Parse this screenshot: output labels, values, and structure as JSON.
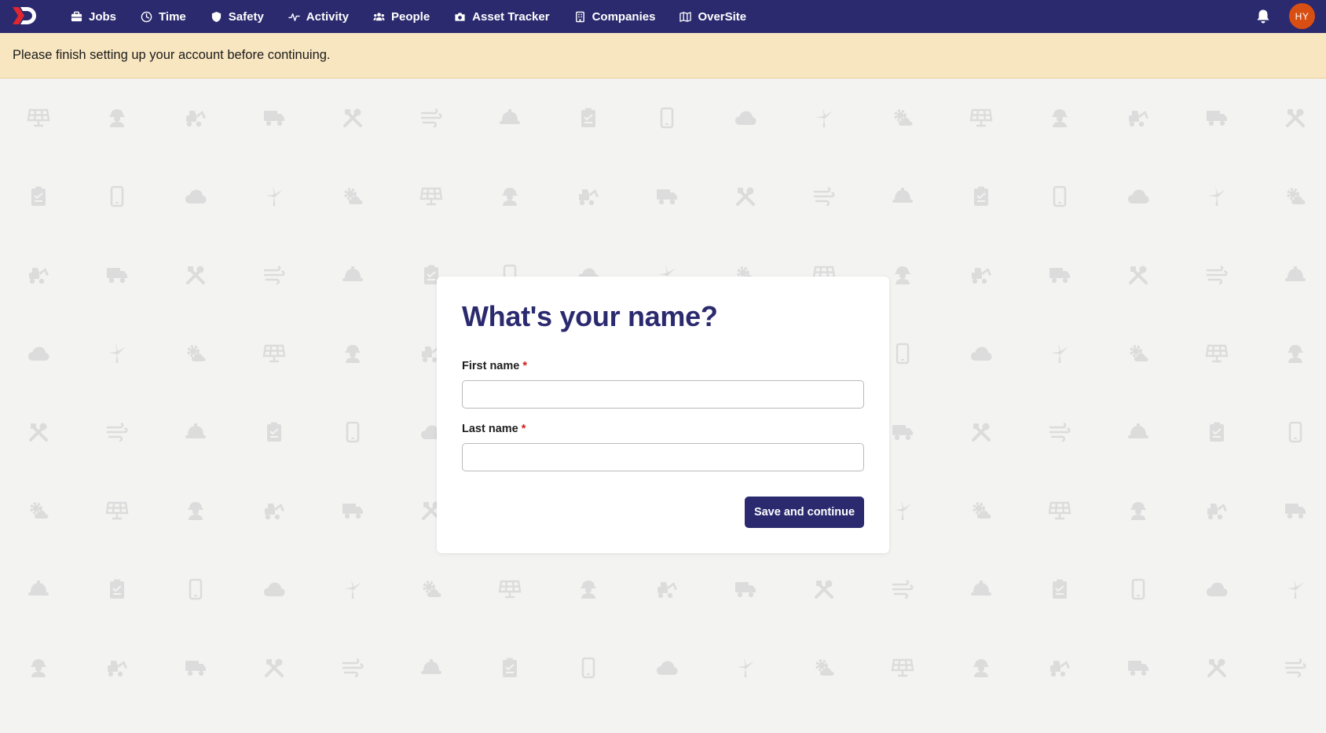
{
  "nav": {
    "items": [
      {
        "label": "Jobs",
        "icon": "briefcase-icon"
      },
      {
        "label": "Time",
        "icon": "clock-icon"
      },
      {
        "label": "Safety",
        "icon": "shield-icon"
      },
      {
        "label": "Activity",
        "icon": "activity-pulse-icon"
      },
      {
        "label": "People",
        "icon": "people-icon"
      },
      {
        "label": "Asset Tracker",
        "icon": "camera-icon"
      },
      {
        "label": "Companies",
        "icon": "building-icon"
      },
      {
        "label": "OverSite",
        "icon": "map-icon"
      }
    ],
    "avatar_initials": "HY",
    "colors": {
      "nav_bg": "#2b2a6f",
      "logo_accent": "#e0262f",
      "avatar_bg": "#d94f13"
    }
  },
  "banner": {
    "text": "Please finish setting up your account before continuing.",
    "bg": "#f8e6c0"
  },
  "form": {
    "title": "What's your name?",
    "first_name_label": "First name",
    "first_name_value": "",
    "last_name_label": "Last name",
    "last_name_value": "",
    "required_marker": "*",
    "save_label": "Save and continue"
  },
  "background_icons": [
    "solar-panel-icon",
    "worker-icon",
    "excavator-icon",
    "truck-icon",
    "tools-icon",
    "wind-icon",
    "hardhat-icon",
    "clipboard-icon",
    "phone-icon",
    "cloud-icon",
    "wind-turbine-icon",
    "gear-cloud-icon"
  ]
}
